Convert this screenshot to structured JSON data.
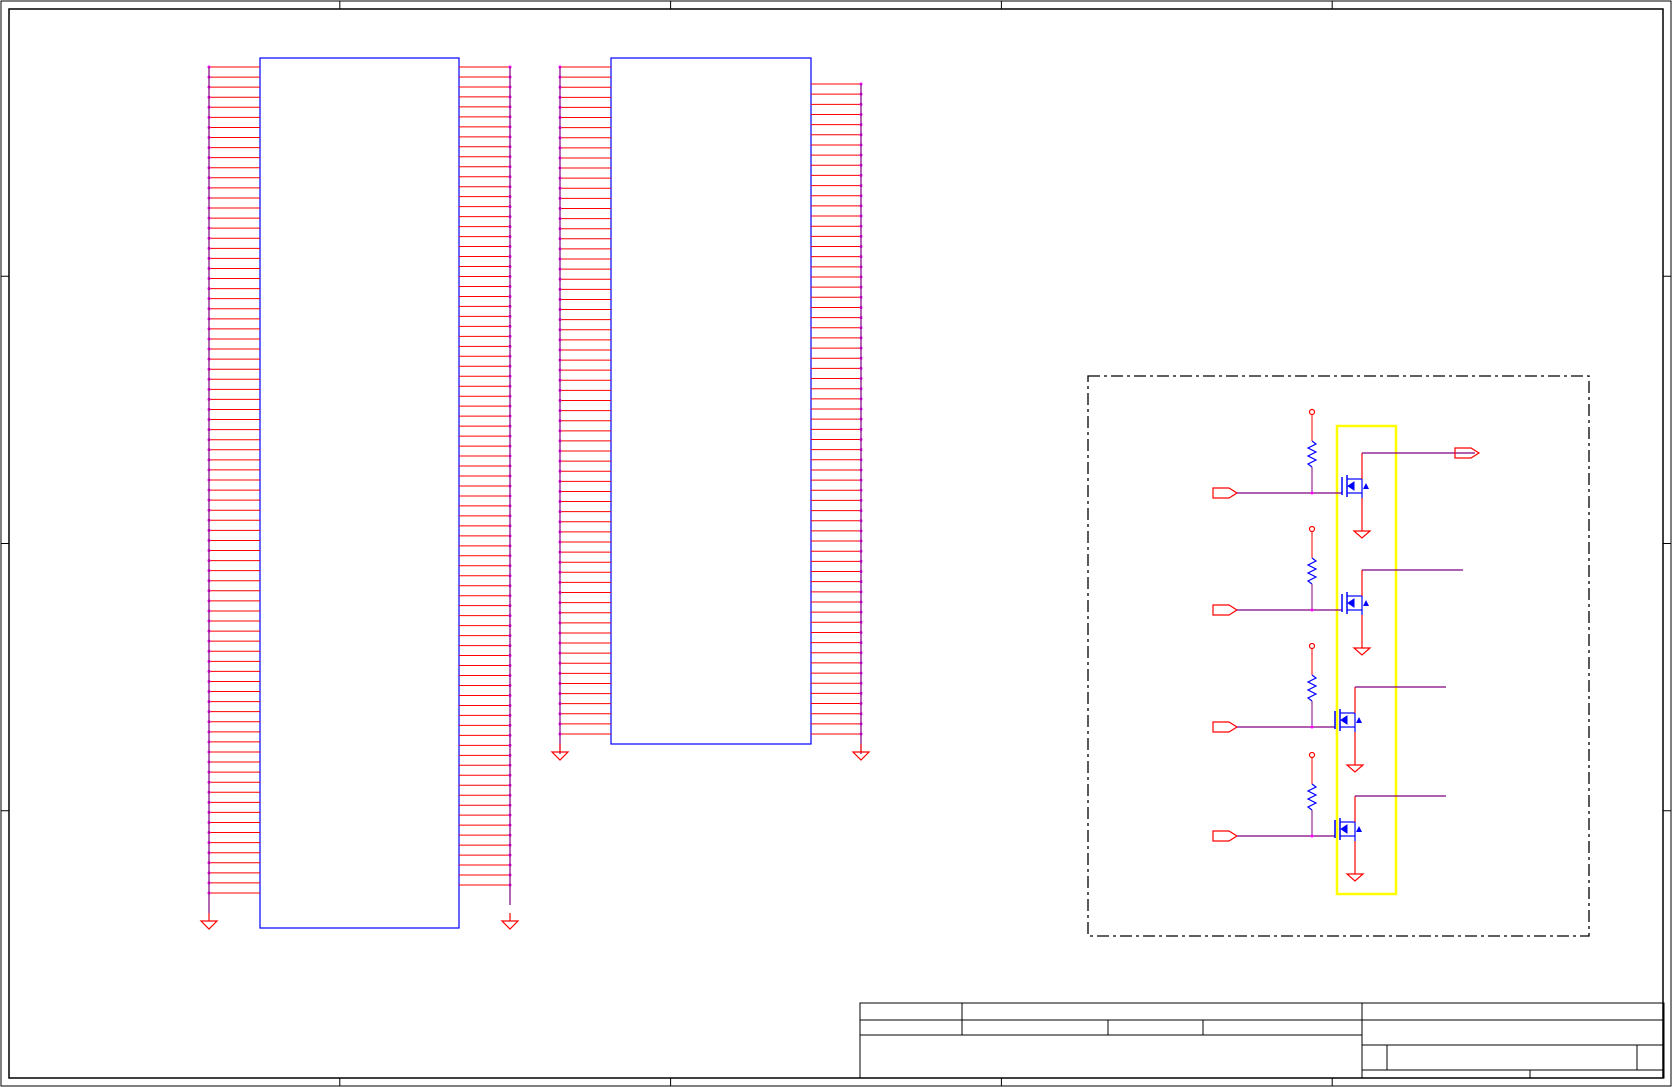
{
  "colors": {
    "frame": "#000000",
    "part_outline": "#0000ff",
    "pin_wire": "#ff0000",
    "net_wire": "#800080",
    "pin_dot": "#ff00ff",
    "highlight_box": "#ffff00",
    "transistor": "#0000ff"
  },
  "schematic": {
    "connectors": [
      {
        "id": "connector-1",
        "left_pins": 83,
        "right_pins": 83
      },
      {
        "id": "connector-2",
        "left_pins": 67,
        "right_pins": 65
      }
    ],
    "driver_block": {
      "channels": 4,
      "channel_type": "n-mosfet-with-pullup",
      "highlight": "mosfet-column"
    },
    "grid": {
      "columns": 5,
      "rows": 4
    },
    "title_block": {}
  }
}
